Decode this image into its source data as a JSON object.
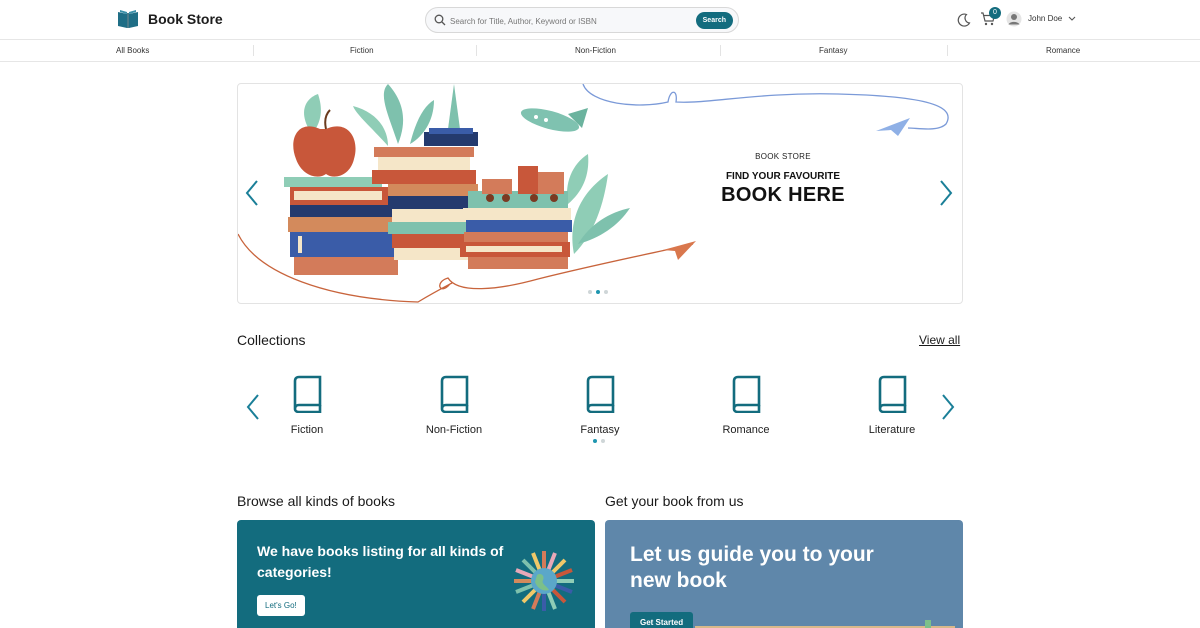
{
  "header": {
    "brand_name": "Book Store",
    "brand_icon": "open-book-icon",
    "search_placeholder": "Search for Title, Author, Keyword or ISBN",
    "search_button": "Search",
    "theme_icon": "moon-icon",
    "cart_icon": "cart-icon",
    "cart_count": "0",
    "user_name": "John Doe",
    "user_icon": "user-icon",
    "user_chevron": "chevron-down-icon"
  },
  "categories": [
    "All Books",
    "Fiction",
    "Non-Fiction",
    "Fantasy",
    "Romance"
  ],
  "hero": {
    "eyebrow": "BOOK STORE",
    "tagline": "FIND YOUR FAVOURITE",
    "headline": "BOOK HERE",
    "slide_count": 3,
    "active_slide": 2
  },
  "collections": {
    "title": "Collections",
    "view_all": "View all",
    "items": [
      "Fiction",
      "Non-Fiction",
      "Fantasy",
      "Romance",
      "Literature"
    ],
    "page_count": 2,
    "active_page": 1
  },
  "browse": {
    "title": "Browse all kinds of books",
    "card_text": "We have books listing for all kinds of categories!",
    "button": "Let's Go!"
  },
  "guide": {
    "title": "Get your book from us",
    "card_text": "Let us guide you to your new book",
    "button": "Get Started"
  },
  "colors": {
    "accent": "#136c7e",
    "accent_light": "#1f96b0",
    "card_blue": "#5f87aa"
  }
}
